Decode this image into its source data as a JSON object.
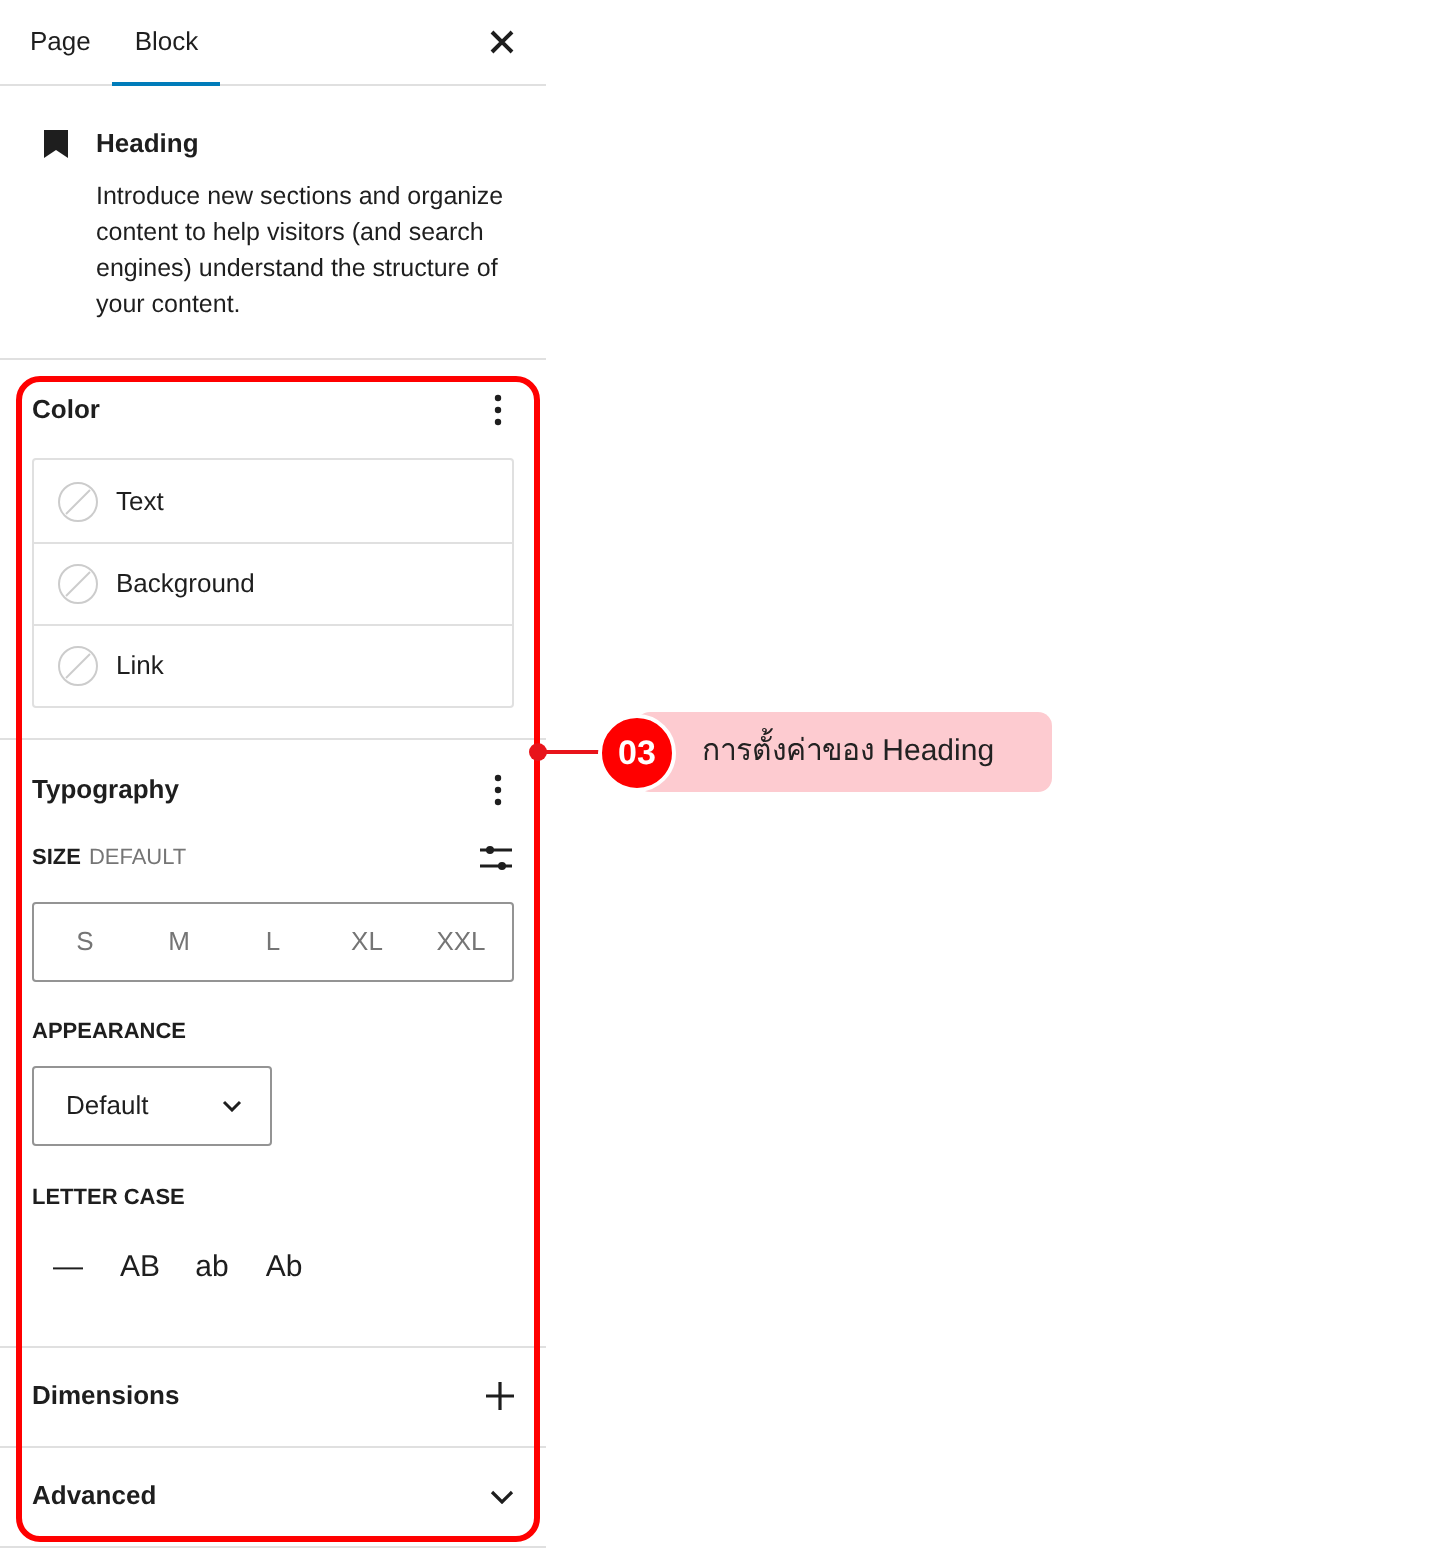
{
  "tabs": [
    {
      "label": "Page",
      "selected": false
    },
    {
      "label": "Block",
      "selected": true
    }
  ],
  "block": {
    "title": "Heading",
    "description": "Introduce new sections and organize content to help visitors (and search engines) understand the structure of your content."
  },
  "color": {
    "title": "Color",
    "items": [
      "Text",
      "Background",
      "Link"
    ]
  },
  "typography": {
    "title": "Typography",
    "size_label": "SIZE",
    "size_value": "DEFAULT",
    "sizes": [
      "S",
      "M",
      "L",
      "XL",
      "XXL"
    ],
    "appearance_label": "APPEARANCE",
    "appearance_value": "Default",
    "letter_case_label": "LETTER CASE",
    "letter_cases": [
      "—",
      "AB",
      "ab",
      "Ab"
    ]
  },
  "sections": [
    {
      "title": "Dimensions",
      "kind": "add"
    },
    {
      "title": "Advanced",
      "kind": "toggle"
    }
  ],
  "annotation": {
    "number": "03",
    "label": "การตั้งค่าของ Heading"
  }
}
